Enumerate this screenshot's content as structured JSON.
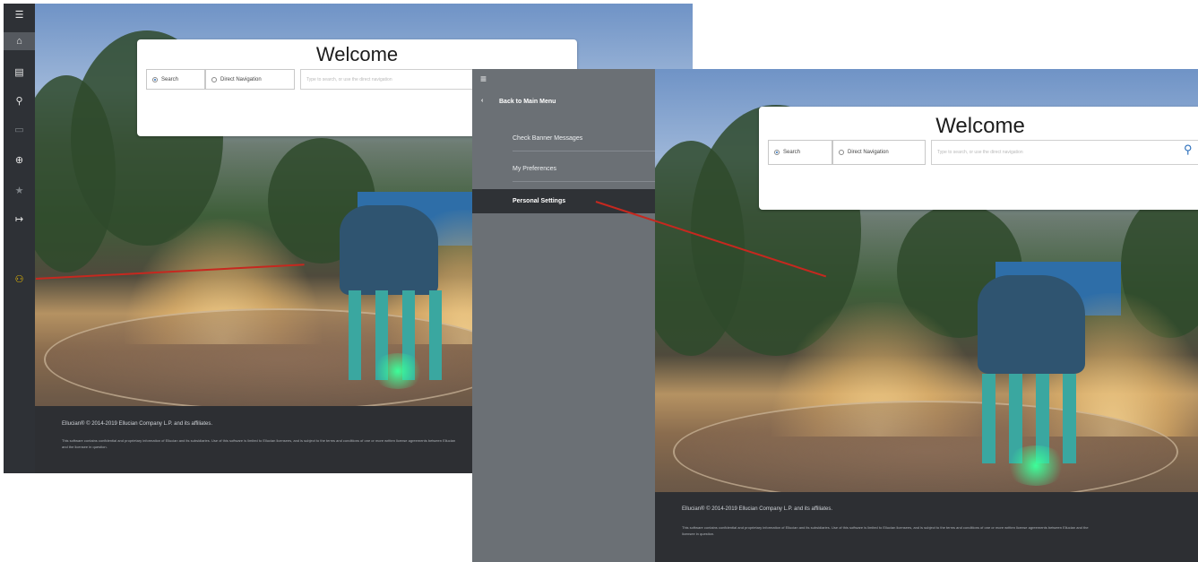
{
  "left_screen": {
    "sidebar": {
      "icons": [
        "menu-icon",
        "home-icon",
        "grid-icon",
        "search-icon",
        "card-icon",
        "help-icon",
        "star-icon",
        "logout-icon",
        "person-settings-icon"
      ]
    },
    "welcome": {
      "title": "Welcome",
      "search_option": "Search",
      "direct_nav_option": "Direct Navigation",
      "search_placeholder": "Type to search, or use the direct navigation"
    },
    "footer": {
      "copyright": "Ellucian® © 2014-2019 Ellucian Company L.P. and its affiliates.",
      "legal": "This software contains confidential and proprietary information of Ellucian and its subsidiaries. Use of this software is limited to Ellucian licensees, and is subject to the terms and conditions of one or more written license agreements between Ellucian and the licensee in question."
    }
  },
  "right_screen": {
    "menu": {
      "hamburger": "≡",
      "back_label": "Back to Main Menu",
      "items": [
        {
          "label": "Check Banner Messages"
        },
        {
          "label": "My Preferences"
        },
        {
          "label": "Personal Settings"
        }
      ]
    },
    "welcome": {
      "title": "Welcome",
      "search_option": "Search",
      "direct_nav_option": "Direct Navigation",
      "search_placeholder": "Type to search, or use the direct navigation"
    },
    "footer": {
      "copyright": "Ellucian® © 2014-2019 Ellucian Company L.P. and its affiliates.",
      "legal": "This software contains confidential and proprietary information of Ellucian and its subsidiaries. Use of this software is limited to Ellucian licensees, and is subject to the terms and conditions of one or more written license agreements between Ellucian and the licensee in question."
    }
  },
  "colors": {
    "annotation_arrow": "#c6281f",
    "sidebar_bg": "#2e3136",
    "menu_bg": "#6b7075",
    "selected_item_bg": "#2f3236"
  }
}
